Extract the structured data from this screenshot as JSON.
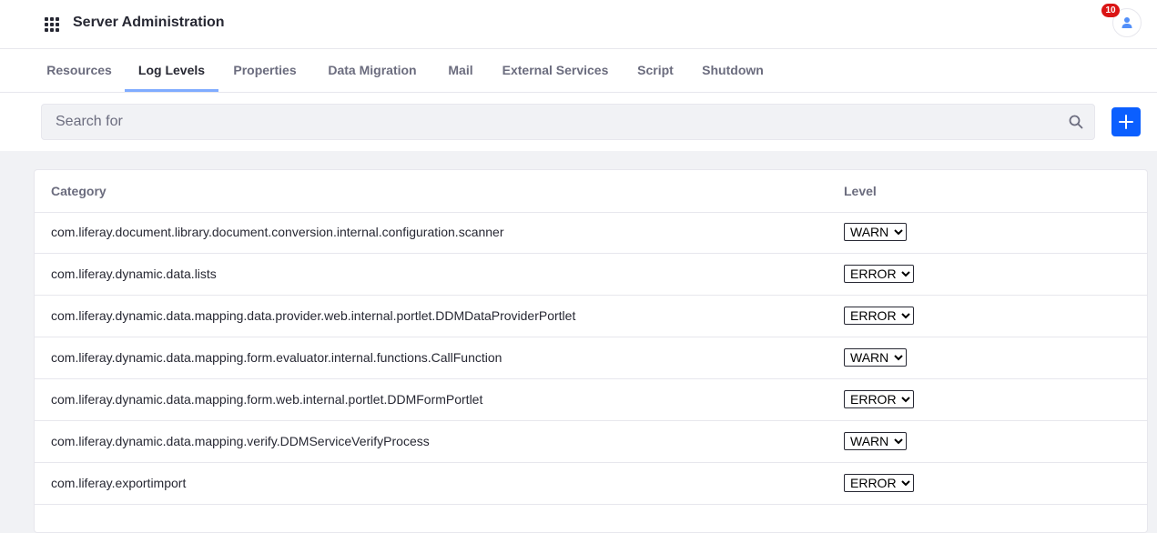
{
  "header": {
    "title": "Server Administration",
    "notification_count": "10"
  },
  "tabs": [
    {
      "label": "Resources",
      "active": false
    },
    {
      "label": "Log Levels",
      "active": true
    },
    {
      "label": "Properties",
      "active": false
    },
    {
      "label": "Data Migration",
      "active": false
    },
    {
      "label": "Mail",
      "active": false
    },
    {
      "label": "External Services",
      "active": false
    },
    {
      "label": "Script",
      "active": false
    },
    {
      "label": "Shutdown",
      "active": false
    }
  ],
  "search": {
    "placeholder": "Search for"
  },
  "table": {
    "columns": {
      "category": "Category",
      "level": "Level"
    },
    "rows": [
      {
        "category": "com.liferay.document.library.document.conversion.internal.configuration.scanner",
        "level": "WARN"
      },
      {
        "category": "com.liferay.dynamic.data.lists",
        "level": "ERROR"
      },
      {
        "category": "com.liferay.dynamic.data.mapping.data.provider.web.internal.portlet.DDMDataProviderPortlet",
        "level": "ERROR"
      },
      {
        "category": "com.liferay.dynamic.data.mapping.form.evaluator.internal.functions.CallFunction",
        "level": "WARN"
      },
      {
        "category": "com.liferay.dynamic.data.mapping.form.web.internal.portlet.DDMFormPortlet",
        "level": "ERROR"
      },
      {
        "category": "com.liferay.dynamic.data.mapping.verify.DDMServiceVerifyProcess",
        "level": "WARN"
      },
      {
        "category": "com.liferay.exportimport",
        "level": "ERROR"
      }
    ]
  },
  "colors": {
    "primary": "#0b5fff",
    "active_tab_underline": "#80acff",
    "badge": "#da1414",
    "avatar_icon": "#528ff9"
  }
}
